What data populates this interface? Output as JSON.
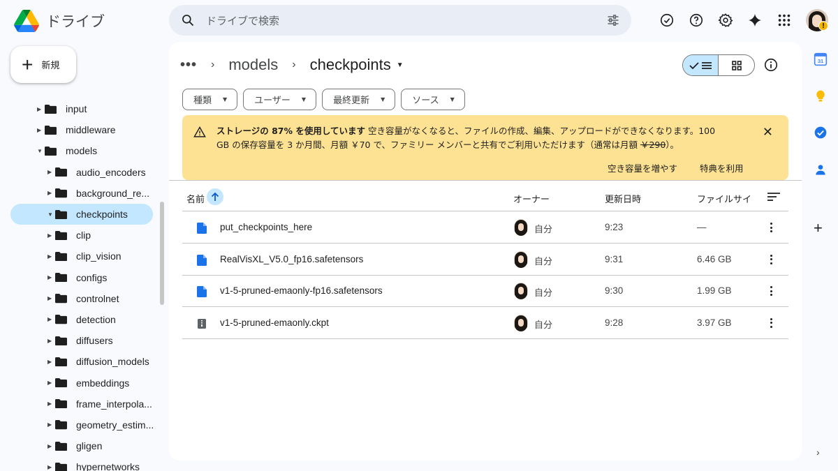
{
  "app": {
    "title": "ドライブ"
  },
  "search": {
    "placeholder": "ドライブで検索"
  },
  "new_button": {
    "label": "新規"
  },
  "sidebar": {
    "items": [
      {
        "label": "input",
        "indent": 1,
        "expanded": false,
        "active": false
      },
      {
        "label": "middleware",
        "indent": 1,
        "expanded": false,
        "active": false
      },
      {
        "label": "models",
        "indent": 1,
        "expanded": true,
        "active": false
      },
      {
        "label": "audio_encoders",
        "indent": 2,
        "expanded": false,
        "active": false
      },
      {
        "label": "background_re...",
        "indent": 2,
        "expanded": false,
        "active": false
      },
      {
        "label": "checkpoints",
        "indent": 2,
        "expanded": true,
        "active": true
      },
      {
        "label": "clip",
        "indent": 2,
        "expanded": false,
        "active": false
      },
      {
        "label": "clip_vision",
        "indent": 2,
        "expanded": false,
        "active": false
      },
      {
        "label": "configs",
        "indent": 2,
        "expanded": false,
        "active": false
      },
      {
        "label": "controlnet",
        "indent": 2,
        "expanded": false,
        "active": false
      },
      {
        "label": "detection",
        "indent": 2,
        "expanded": false,
        "active": false
      },
      {
        "label": "diffusers",
        "indent": 2,
        "expanded": false,
        "active": false
      },
      {
        "label": "diffusion_models",
        "indent": 2,
        "expanded": false,
        "active": false
      },
      {
        "label": "embeddings",
        "indent": 2,
        "expanded": false,
        "active": false
      },
      {
        "label": "frame_interpola...",
        "indent": 2,
        "expanded": false,
        "active": false
      },
      {
        "label": "geometry_estim...",
        "indent": 2,
        "expanded": false,
        "active": false
      },
      {
        "label": "gligen",
        "indent": 2,
        "expanded": false,
        "active": false
      },
      {
        "label": "hypernetworks",
        "indent": 2,
        "expanded": false,
        "active": false
      }
    ]
  },
  "breadcrumb": {
    "overflow": "•••",
    "parent": "models",
    "current": "checkpoints"
  },
  "filters": [
    "種類",
    "ユーザー",
    "最終更新",
    "ソース"
  ],
  "banner": {
    "bold": "ストレージの 87% を使用しています",
    "line1": " 空き容量がなくなると、ファイルの作成、編集、アップロードができなくなります。100",
    "line2_a": "GB の保存容量を 3 か月間、月額 ￥70 で、ファミリー メンバーと共有でご利用いただけます（通常は月額 ",
    "line2_strike": "￥290",
    "line2_b": "）。",
    "action1": "空き容量を増やす",
    "action2": "特典を利用"
  },
  "table": {
    "headers": {
      "name": "名前",
      "owner": "オーナー",
      "modified": "更新日時",
      "size": "ファイルサイ"
    },
    "rows": [
      {
        "name": "put_checkpoints_here",
        "type": "doc",
        "owner": "自分",
        "modified": "9:23",
        "size": "—"
      },
      {
        "name": "RealVisXL_V5.0_fp16.safetensors",
        "type": "doc",
        "owner": "自分",
        "modified": "9:31",
        "size": "6.46 GB"
      },
      {
        "name": "v1-5-pruned-emaonly-fp16.safetensors",
        "type": "doc",
        "owner": "自分",
        "modified": "9:30",
        "size": "1.99 GB"
      },
      {
        "name": "v1-5-pruned-emaonly.ckpt",
        "type": "binary",
        "owner": "自分",
        "modified": "9:28",
        "size": "3.97 GB"
      }
    ]
  },
  "colors": {
    "accent": "#c2e7ff",
    "doc_blue": "#1a73e8",
    "banner": "#fde293",
    "search_bg": "#e9eef6"
  },
  "icons": {
    "header": [
      "offline-check-icon",
      "help-icon",
      "settings-icon",
      "gemini-icon",
      "apps-grid-icon"
    ],
    "rail": [
      "calendar-icon",
      "keep-icon",
      "tasks-icon",
      "contacts-icon"
    ]
  }
}
